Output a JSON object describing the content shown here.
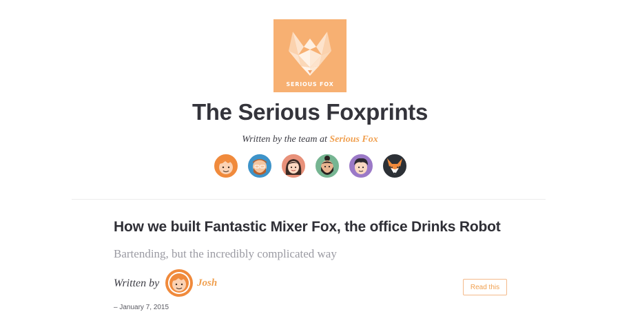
{
  "header": {
    "logo": {
      "text": "SERIOUS FOX",
      "bg_color": "#f7b072",
      "icon": "fox-logo-icon"
    },
    "title": "The Serious Foxprints",
    "byline_prefix": "Written by the team at",
    "byline_link": "Serious Fox",
    "accent_color": "#f0a050"
  },
  "team": [
    {
      "icon": "team-member-1-avatar",
      "ring_color": "#f08a3c"
    },
    {
      "icon": "team-member-2-avatar",
      "ring_color": "#3d93c9"
    },
    {
      "icon": "team-member-3-avatar",
      "ring_color": "#e8917a"
    },
    {
      "icon": "team-member-4-avatar",
      "ring_color": "#76b592"
    },
    {
      "icon": "team-member-5-avatar",
      "ring_color": "#9b79c7"
    },
    {
      "icon": "fox-avatar",
      "ring_color": "#2c3036"
    }
  ],
  "post": {
    "title": "How we built Fantastic Mixer Fox, the office Drinks Robot",
    "subtitle": "Bartending, but the incredibly complicated way",
    "written_by": "Written by",
    "author": "Josh",
    "read_label": "Read this",
    "date": "– January 7, 2015"
  }
}
